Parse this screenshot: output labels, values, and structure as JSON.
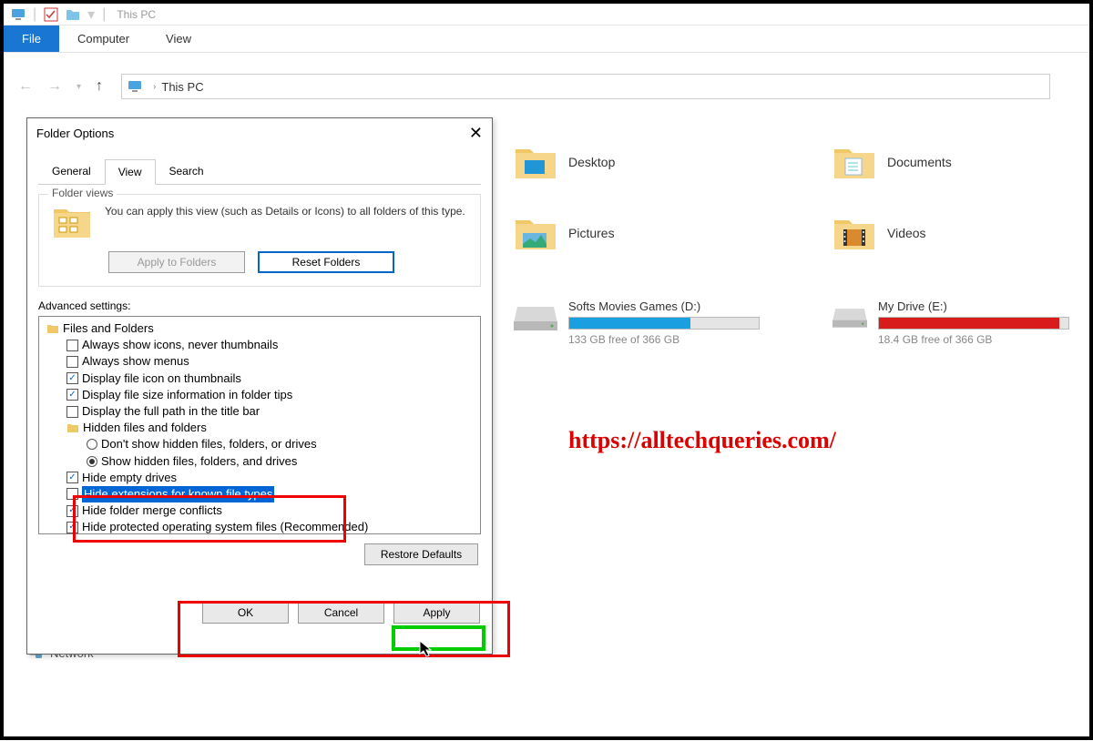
{
  "window": {
    "title": "This PC"
  },
  "ribbon": {
    "file": "File",
    "computer": "Computer",
    "view": "View"
  },
  "address": {
    "location": "This PC"
  },
  "folders": [
    {
      "name": "Desktop",
      "icon": "desktop"
    },
    {
      "name": "Documents",
      "icon": "documents"
    },
    {
      "name": "Pictures",
      "icon": "pictures"
    },
    {
      "name": "Videos",
      "icon": "videos"
    }
  ],
  "drives": [
    {
      "name": "Softs Movies Games (D:)",
      "free": "133 GB free of 366 GB",
      "fill_pct": 64,
      "color": "#1a9fe0"
    },
    {
      "name": "My Drive (E:)",
      "free": "18.4 GB free of 366 GB",
      "fill_pct": 95,
      "color": "#d81b1b"
    }
  ],
  "watermark": "https://alltechqueries.com/",
  "network": "Network",
  "dialog": {
    "title": "Folder Options",
    "tabs": {
      "general": "General",
      "view": "View",
      "search": "Search"
    },
    "folder_views": {
      "legend": "Folder views",
      "text": "You can apply this view (such as Details or Icons) to all folders of this type.",
      "apply_to_folders": "Apply to Folders",
      "reset_folders": "Reset Folders"
    },
    "advanced_label": "Advanced settings:",
    "tree": {
      "root": "Files and Folders",
      "items": [
        {
          "label": "Always show icons, never thumbnails",
          "type": "check",
          "checked": false
        },
        {
          "label": "Always show menus",
          "type": "check",
          "checked": false
        },
        {
          "label": "Display file icon on thumbnails",
          "type": "check",
          "checked": true
        },
        {
          "label": "Display file size information in folder tips",
          "type": "check",
          "checked": true
        },
        {
          "label": "Display the full path in the title bar",
          "type": "check",
          "checked": false
        }
      ],
      "hidden_group": "Hidden files and folders",
      "hidden_items": [
        {
          "label": "Don't show hidden files, folders, or drives",
          "type": "radio",
          "checked": false
        },
        {
          "label": "Show hidden files, folders, and drives",
          "type": "radio",
          "checked": true
        }
      ],
      "bottom_items": [
        {
          "label": "Hide empty drives",
          "type": "check",
          "checked": true
        },
        {
          "label": "Hide extensions for known file types",
          "type": "check",
          "checked": false,
          "highlighted": true
        },
        {
          "label": "Hide folder merge conflicts",
          "type": "check",
          "checked": true
        },
        {
          "label": "Hide protected operating system files (Recommended)",
          "type": "check",
          "checked": true
        }
      ]
    },
    "restore_defaults": "Restore Defaults",
    "ok": "OK",
    "cancel": "Cancel",
    "apply": "Apply"
  }
}
